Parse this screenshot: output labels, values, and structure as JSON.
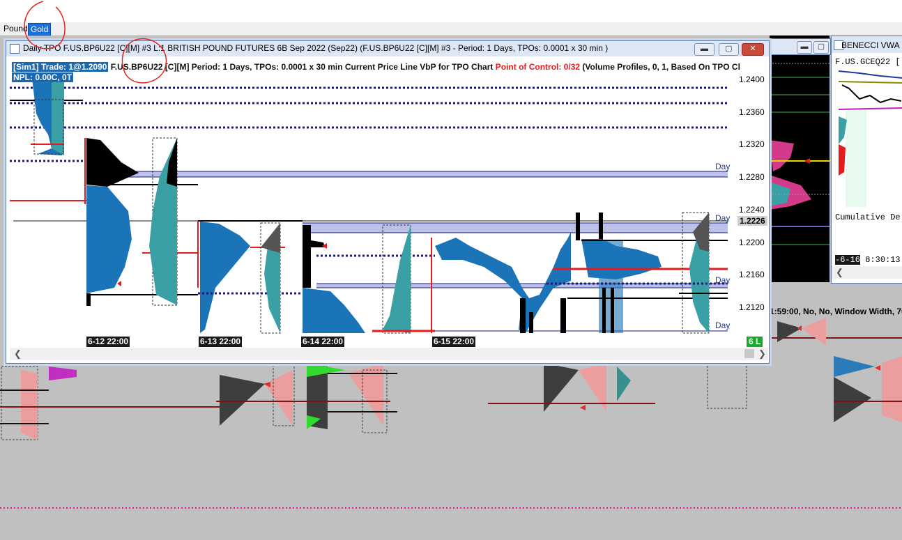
{
  "tabs": [
    "Pound",
    "Gold"
  ],
  "main_window": {
    "title": "Daily TPO F.US.BP6U22 [C][M]  #3 L:1  BRITISH POUND FUTURES 6B Sep 2022 (Sep22) (F.US.BP6U22 [C][M]  #3 - Period: 1 Days, TPOs: 0.0001 x 30 min  )",
    "controls": {
      "minimize": "▬",
      "maximize": "▢",
      "close": "✕"
    },
    "info": {
      "trade": "[Sim1]  Trade: 1@1.2090",
      "symbol_info": "F.US.BP6U22 [C][M] Period: 1 Days, TPOs: 0.0001 x 30 min   Current Price Line  VbP for TPO Chart",
      "poc": "Point of Control: 0/32",
      "extra": "(Volume Profiles, 0, 1, Based On TPO Cl",
      "npl": "NPL: 0.00C, 0T"
    },
    "y_axis": {
      "ticks": [
        "1.2400",
        "1.2360",
        "1.2320",
        "1.2280",
        "1.2240",
        "1.2200",
        "1.2160",
        "1.2120"
      ],
      "current_price": "1.2226"
    },
    "dates": [
      "6-12  22:00",
      "6-13  22:00",
      "6-14  22:00",
      "6-15  22:00"
    ],
    "day_label": "Day",
    "status_badge": "6 L"
  },
  "right_window": {
    "title": "BENECCI VWA",
    "symbol": "F.US.GCEQ22 [",
    "cumulative": "Cumulative De",
    "date": "-6-16",
    "time": "8:30:13"
  },
  "background_text": "1:59:00, No, No, Window Width, 70",
  "colors": {
    "tpo_blue": "#1b74b8",
    "tpo_black": "#000000",
    "volume_teal": "#3aa0a5",
    "poc_red": "#e51c1c",
    "value_area": "#9ea6e0",
    "navy_dotted": "#1a1a70",
    "annotation_red": "#e5241c"
  }
}
